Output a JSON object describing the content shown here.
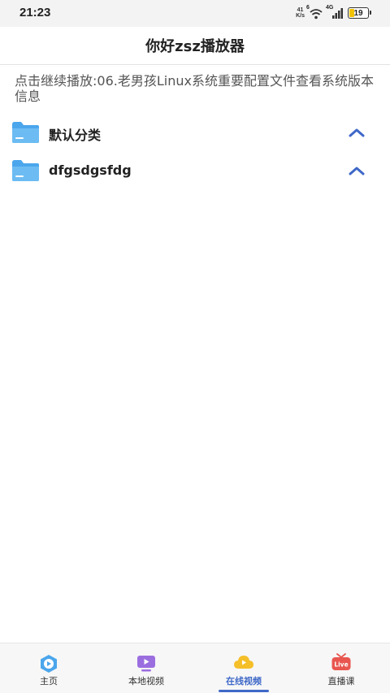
{
  "status_bar": {
    "time": "21:23",
    "net_speed_value": "41",
    "net_speed_unit": "K/s",
    "wifi_label": "6",
    "cell_label": "4G",
    "battery_level": "19"
  },
  "header": {
    "title": "你好zsz播放器"
  },
  "resume": {
    "text": "点击继续播放:06.老男孩Linux系统重要配置文件查看系统版本信息"
  },
  "categories": [
    {
      "name": "默认分类"
    },
    {
      "name": "dfgsdgsfdg"
    }
  ],
  "bottom_nav": {
    "active_index": 2,
    "items": [
      {
        "label": "主页",
        "icon": "home-play-icon"
      },
      {
        "label": "本地视频",
        "icon": "local-video-icon"
      },
      {
        "label": "在线视频",
        "icon": "cloud-play-icon"
      },
      {
        "label": "直播课",
        "icon": "live-tv-icon"
      }
    ]
  },
  "colors": {
    "accent": "#3f68c8",
    "folder": "#4ba6ec",
    "status_bar_bg": "#f3f3f3"
  }
}
